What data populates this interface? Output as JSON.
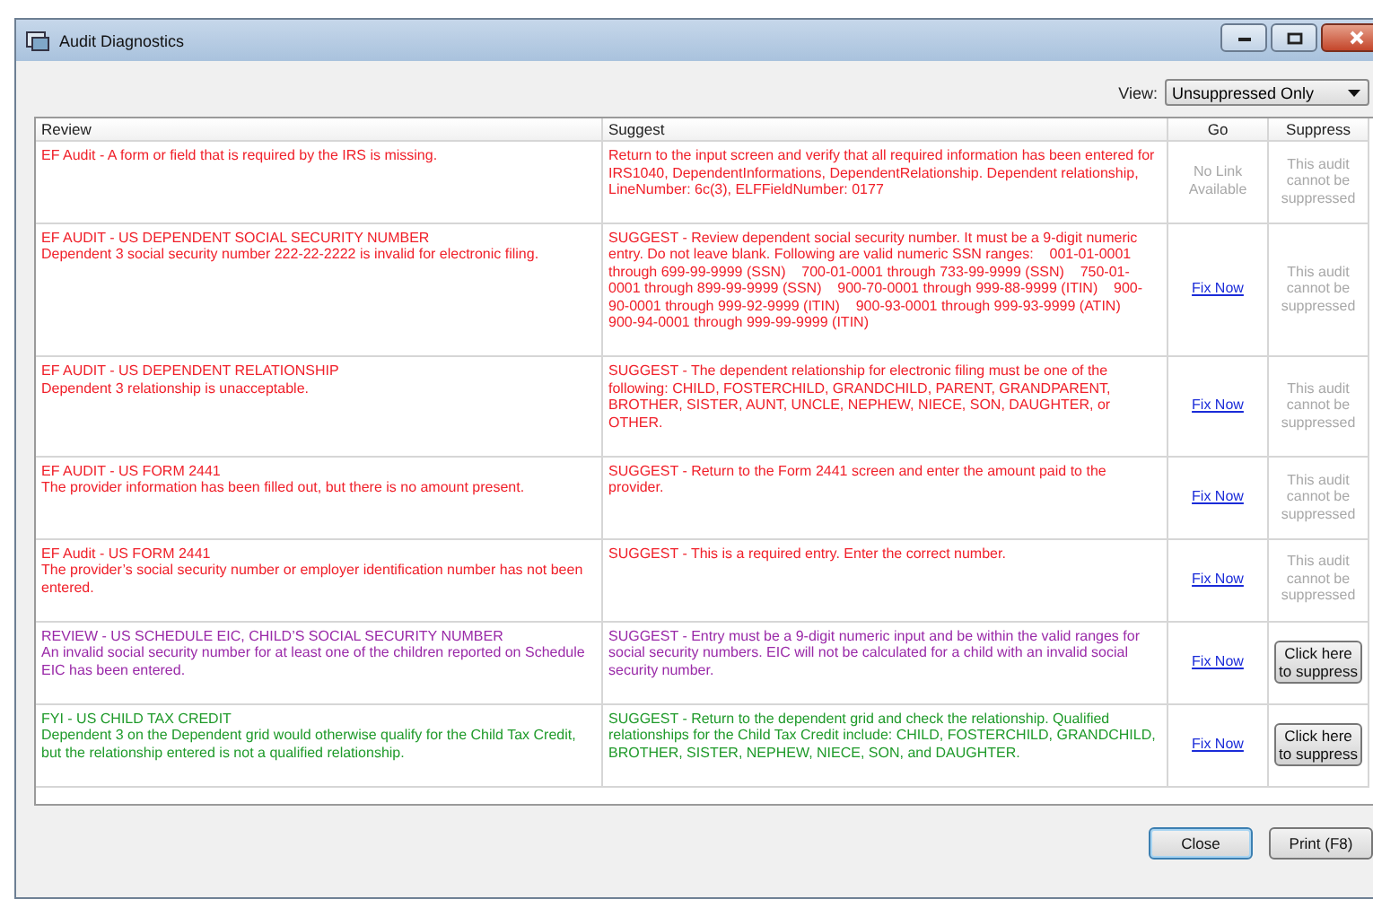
{
  "window": {
    "title": "Audit Diagnostics"
  },
  "view": {
    "label": "View:",
    "value": "Unsuppressed Only"
  },
  "table": {
    "columns": [
      "Review",
      "Suggest",
      "Go",
      "Suppress"
    ],
    "rows": [
      {
        "kind": "error",
        "review_title": "EF Audit - A form or field that is required by the IRS is missing.",
        "suggest": "Return to the input screen and verify that all required information has been entered for IRS1040, DependentInformations, DependentRelationship. Dependent relationship, LineNumber: 6c(3), ELFFieldNumber: 0177",
        "go": {
          "kind": "none",
          "text": "No Link Available"
        },
        "suppress": {
          "kind": "note",
          "text": "This audit cannot be suppressed"
        }
      },
      {
        "kind": "error",
        "review_title": "EF AUDIT - US DEPENDENT SOCIAL SECURITY NUMBER",
        "review_detail": "Dependent 3 social security number 222-22-2222 is invalid for electronic filing.",
        "suggest": "SUGGEST - Review dependent social security number. It must be a 9-digit numeric entry. Do not leave blank. Following are valid numeric SSN ranges:    001-01-0001 through 699-99-9999 (SSN)    700-01-0001 through 733-99-9999 (SSN)    750-01-0001 through 899-99-9999 (SSN)    900-70-0001 through 999-88-9999 (ITIN)    900-90-0001 through 999-92-9999 (ITIN)    900-93-0001 through 999-93-9999 (ATIN)    900-94-0001 through 999-99-9999 (ITIN)",
        "go": {
          "kind": "link",
          "text": "Fix Now"
        },
        "suppress": {
          "kind": "note",
          "text": "This audit cannot be suppressed"
        }
      },
      {
        "kind": "error",
        "review_title": "EF AUDIT - US DEPENDENT RELATIONSHIP",
        "review_detail": "Dependent 3 relationship is unacceptable.",
        "suggest": "SUGGEST - The dependent relationship for electronic filing must be one of the following: CHILD, FOSTERCHILD, GRANDCHILD, PARENT, GRANDPARENT, BROTHER, SISTER, AUNT, UNCLE, NEPHEW, NIECE, SON, DAUGHTER, or OTHER.",
        "go": {
          "kind": "link",
          "text": "Fix Now"
        },
        "suppress": {
          "kind": "note",
          "text": "This audit cannot be suppressed"
        }
      },
      {
        "kind": "error",
        "review_title": "EF AUDIT - US FORM 2441",
        "review_detail": "The provider information has been filled out, but there is no amount present.",
        "suggest": "SUGGEST - Return to the Form 2441 screen and enter the amount paid to the provider.",
        "go": {
          "kind": "link",
          "text": "Fix Now"
        },
        "suppress": {
          "kind": "note",
          "text": "This audit cannot be suppressed"
        }
      },
      {
        "kind": "error",
        "review_title": "EF Audit - US FORM 2441",
        "review_detail": "The provider’s social security number or employer identification number has not been entered.",
        "suggest": "SUGGEST - This is a required entry. Enter the correct number.",
        "go": {
          "kind": "link",
          "text": "Fix Now"
        },
        "suppress": {
          "kind": "note",
          "text": "This audit cannot be suppressed"
        }
      },
      {
        "kind": "review",
        "review_title": "REVIEW - US SCHEDULE EIC, CHILD’S SOCIAL SECURITY NUMBER",
        "review_detail": "An invalid social security number for at least one of the children reported on Schedule EIC has been entered.",
        "suggest": "SUGGEST - Entry must be a 9-digit numeric input and be within the valid ranges for social security numbers. EIC will not be calculated for a child with an invalid social security number.",
        "go": {
          "kind": "link",
          "text": "Fix Now"
        },
        "suppress": {
          "kind": "button",
          "text": "Click here to suppress"
        }
      },
      {
        "kind": "fyi",
        "review_title": "FYI - US CHILD TAX CREDIT",
        "review_detail": "Dependent 3 on the Dependent grid would otherwise qualify for the Child Tax Credit, but the relationship entered is not a qualified relationship.",
        "suggest": "SUGGEST - Return to the dependent grid and check the relationship. Qualified relationships for the Child Tax Credit include: CHILD, FOSTERCHILD, GRANDCHILD, BROTHER, SISTER, NEPHEW, NIECE, SON, and DAUGHTER.",
        "go": {
          "kind": "link",
          "text": "Fix Now"
        },
        "suppress": {
          "kind": "button",
          "text": "Click here to suppress"
        }
      }
    ]
  },
  "buttons": [
    {
      "label": "Close",
      "focused": true
    },
    {
      "label": "Print (F8)",
      "focused": false
    }
  ]
}
